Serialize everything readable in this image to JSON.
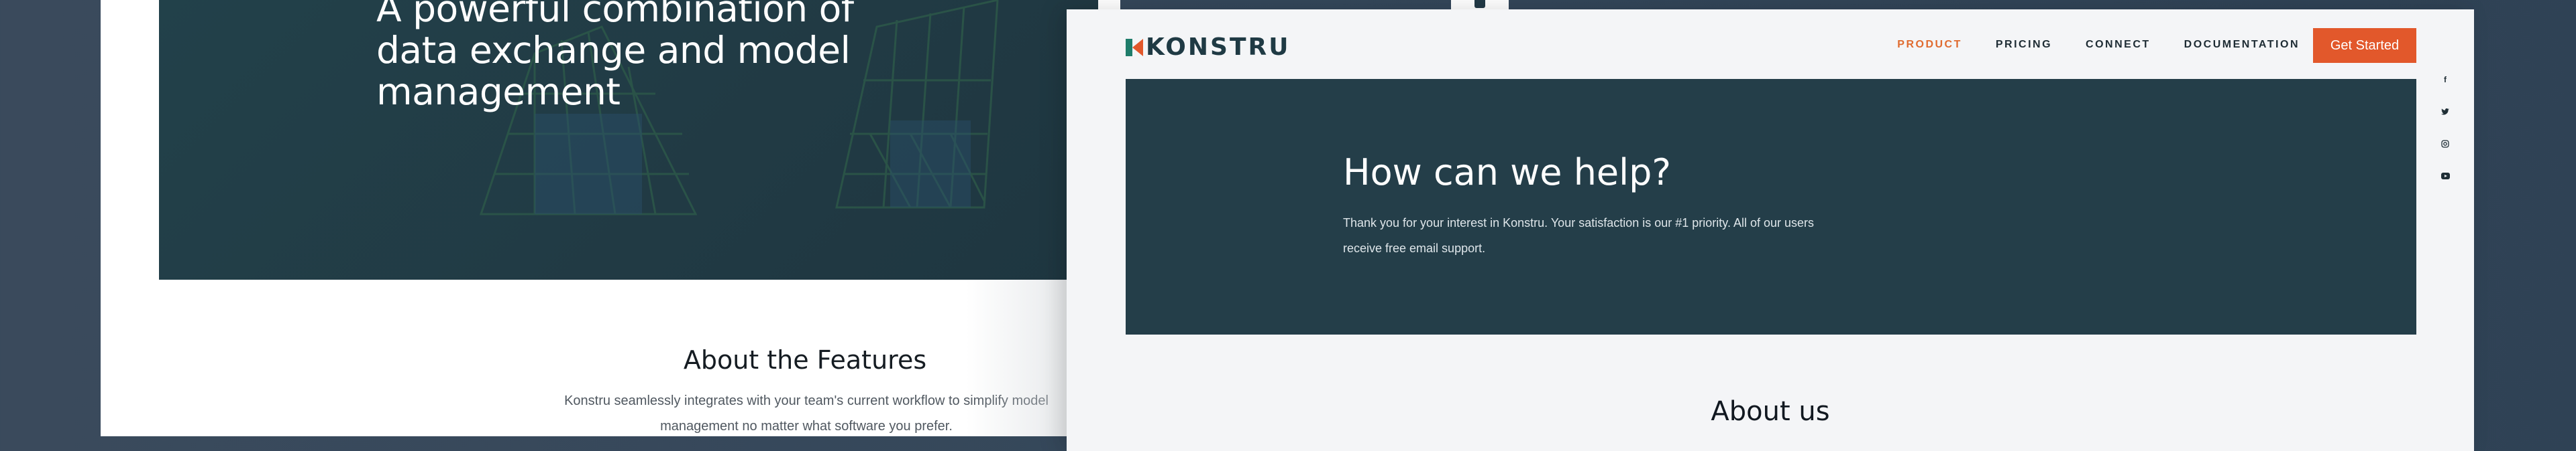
{
  "back_page": {
    "hero_title": "A powerful combination of data exchange and model management",
    "features_title": "About the Features",
    "features_text": "Konstru seamlessly integrates with your team's current workflow to simplify model management no matter what software you prefer."
  },
  "front_page": {
    "logo_text": "KONSTRU",
    "nav": [
      {
        "label": "PRODUCT",
        "active": true
      },
      {
        "label": "PRICING",
        "active": false
      },
      {
        "label": "CONNECT",
        "active": false
      },
      {
        "label": "DOCUMENTATION",
        "active": false
      }
    ],
    "cta_label": "Get Started",
    "help_title": "How can we help?",
    "help_text": "Thank you for your interest in Konstru. Your satisfaction is our #1 priority. All of our users receive free email support.",
    "about_title": "About us"
  },
  "social": [
    {
      "icon": "facebook-icon",
      "glyph": "f"
    },
    {
      "icon": "twitter-icon",
      "glyph": "🐦"
    },
    {
      "icon": "instagram-icon",
      "glyph": "◎"
    },
    {
      "icon": "youtube-icon",
      "glyph": "▶"
    }
  ],
  "colors": {
    "brand_dark": "#243e49",
    "accent_orange": "#e2582b",
    "logo_green": "#1f7d6b"
  }
}
